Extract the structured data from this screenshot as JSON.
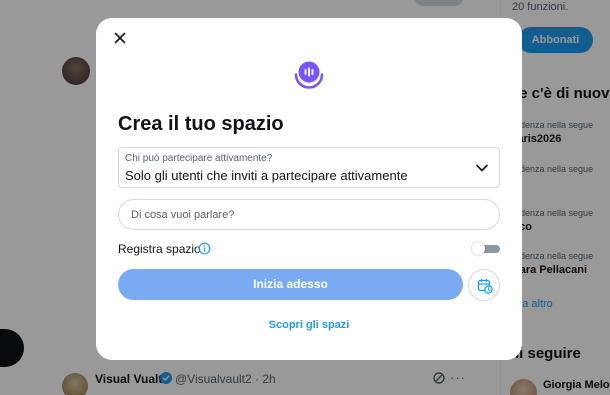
{
  "background": {
    "tweet": {
      "name": "Visual Vualt",
      "handle_time": "@Visualvault2 · 2h",
      "more_label": "···"
    },
    "sidebar": {
      "features_text": "20 funzioni.",
      "subscribed_button": "Abbonati",
      "trends_title": "he c'è di nuov",
      "trends": [
        {
          "meta": "endenza nella segue",
          "name": "Paris2026"
        },
        {
          "meta": "endenza nella segue",
          "name": "s"
        },
        {
          "meta": "endenza nella segue",
          "name": "isco"
        },
        {
          "meta": "endenza nella segue",
          "name": "hiara Pellacani"
        }
      ],
      "show_more": "stra altro",
      "follow_title": "hi seguire",
      "follow_name": "Giorgia Melo"
    }
  },
  "modal": {
    "title": "Crea il tuo spazio",
    "who_can_speak": {
      "label": "Chi può partecipare attivamente?",
      "value": "Solo gli utenti che inviti a partecipare attivamente"
    },
    "topic_input": {
      "placeholder": "Di cosa vuoi parlare?",
      "value": ""
    },
    "record": {
      "label": "Registra spazio",
      "enabled": false
    },
    "start_button": "Inizia adesso",
    "discover_link": "Scopri gli spazi"
  },
  "colors": {
    "accent": "#1d9bf0",
    "start_button": "#7aabf2",
    "logo": "#7856ff",
    "overlay": "rgba(0,0,0,0.40)"
  },
  "icons": [
    "close-icon",
    "spaces-logo-icon",
    "chevron-down-icon",
    "info-icon",
    "schedule-calendar-icon",
    "verified-badge-icon"
  ]
}
